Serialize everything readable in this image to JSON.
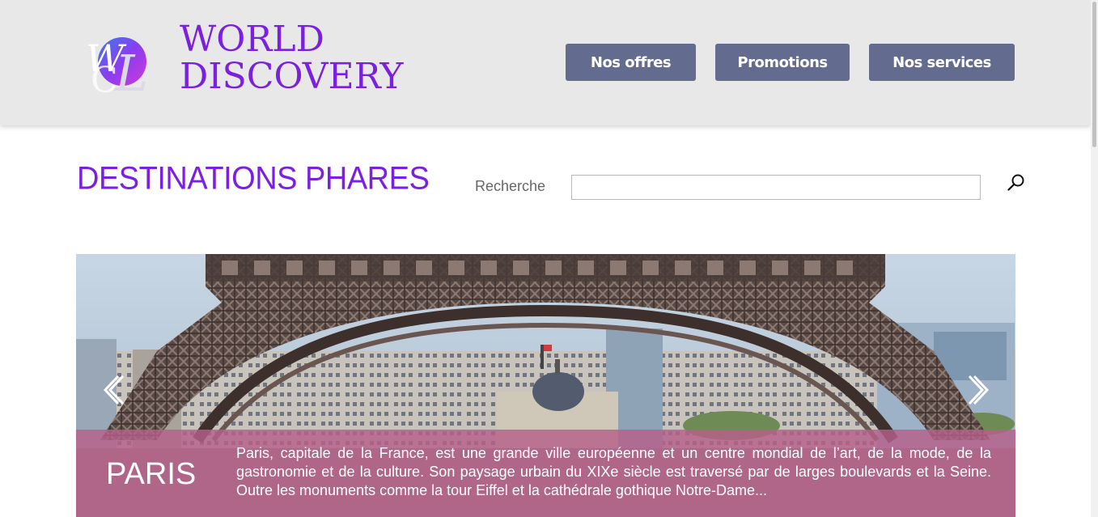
{
  "brand": {
    "name_line1": "WORLD",
    "name_line2": "DISCOVERY",
    "monogram_text": "WDL",
    "color": "#7b1fe0"
  },
  "nav": {
    "items": [
      {
        "label": "Nos offres"
      },
      {
        "label": "Promotions"
      },
      {
        "label": "Nos services"
      }
    ],
    "button_color": "#636b8f"
  },
  "section": {
    "title": "DESTINATIONS PHARES"
  },
  "search": {
    "label": "Recherche",
    "value": "",
    "placeholder": "",
    "icon": "search-icon"
  },
  "carousel": {
    "prev_icon": "chevron-left-icon",
    "next_icon": "chevron-right-icon",
    "slides": [
      {
        "city": "PARIS",
        "description": "Paris, capitale de la France, est une grande ville européenne et un centre mondial de l’art, de la mode, de la gastronomie et de la culture. Son paysage urbain du XIXe siècle est traversé par de larges boulevards et la Seine. Outre les monuments comme la tour Eiffel et la cathédrale gothique Notre-Dame...",
        "image": "eiffel-tower-photo"
      }
    ],
    "caption_color": "#b6608a"
  }
}
